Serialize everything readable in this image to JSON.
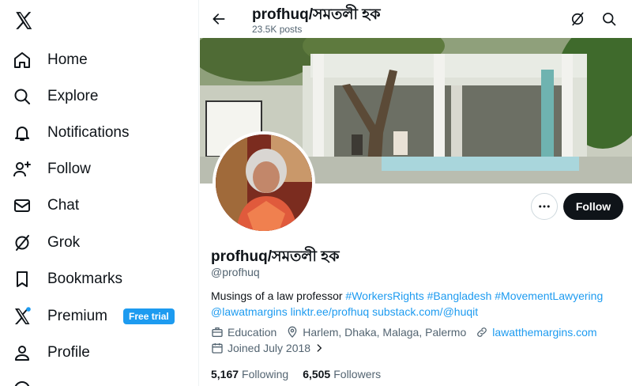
{
  "sidebar": {
    "logo": "x-logo-icon",
    "items": [
      {
        "label": "Home",
        "icon": "home-icon"
      },
      {
        "label": "Explore",
        "icon": "search-icon"
      },
      {
        "label": "Notifications",
        "icon": "bell-icon"
      },
      {
        "label": "Follow",
        "icon": "person-plus-icon"
      },
      {
        "label": "Chat",
        "icon": "envelope-icon"
      },
      {
        "label": "Grok",
        "icon": "grok-icon"
      },
      {
        "label": "Bookmarks",
        "icon": "bookmark-icon"
      },
      {
        "label": "Premium",
        "icon": "x-premium-icon",
        "badge": "Free trial"
      },
      {
        "label": "Profile",
        "icon": "person-icon"
      }
    ]
  },
  "header": {
    "title": "profhuq/সমতলী হক",
    "posts": "23.5K posts"
  },
  "profile": {
    "name": "profhuq/সমতলী হক",
    "handle": "@profhuq",
    "bio_text": "Musings of a law professor ",
    "bio_links": [
      "#WorkersRights",
      "#Bangladesh",
      "#MovementLawyering",
      "@lawatmargins",
      "linktr.ee/profhuq",
      "substack.com/@huqit"
    ],
    "category": "Education",
    "location": "Harlem, Dhaka, Malaga, Palermo",
    "website": "lawatthemargins.com",
    "joined": "Joined July 2018",
    "following_count": "5,167",
    "following_label": "Following",
    "followers_count": "6,505",
    "followers_label": "Followers",
    "follow_button": "Follow"
  },
  "colors": {
    "accent": "#1d9bf0",
    "text": "#0f1419",
    "muted": "#536471"
  }
}
